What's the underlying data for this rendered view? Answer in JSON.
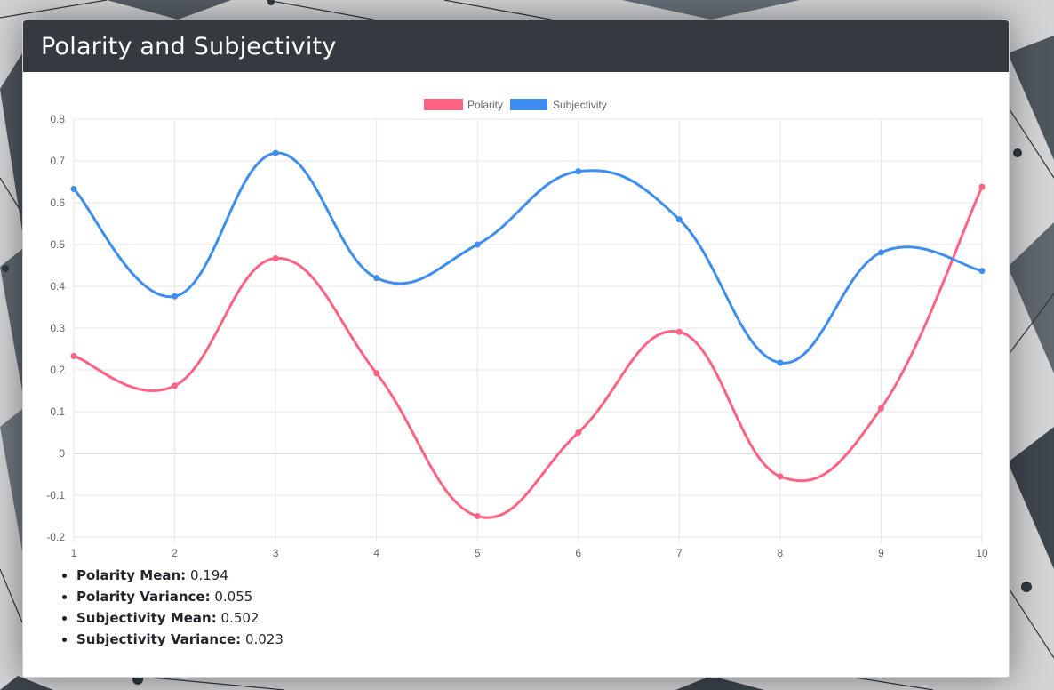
{
  "header": {
    "title": "Polarity and Subjectivity"
  },
  "chart_data": {
    "type": "line",
    "x": [
      1,
      2,
      3,
      4,
      5,
      6,
      7,
      8,
      9,
      10
    ],
    "ylim": [
      -0.2,
      0.8
    ],
    "yticks": [
      "0.8",
      "0.7",
      "0.6",
      "0.5",
      "0.4",
      "0.3",
      "0.2",
      "0.1",
      "0",
      "-0.1",
      "-0.2"
    ],
    "xticks": [
      "1",
      "2",
      "3",
      "4",
      "5",
      "6",
      "7",
      "8",
      "9",
      "10"
    ],
    "grid": true,
    "smooth": true,
    "legend_position": "top",
    "title": "",
    "xlabel": "",
    "ylabel": "",
    "series": [
      {
        "name": "Polarity",
        "color": "#ff6384",
        "values": [
          0.233,
          0.162,
          0.467,
          0.192,
          -0.15,
          0.05,
          0.291,
          -0.055,
          0.108,
          0.638
        ]
      },
      {
        "name": "Subjectivity",
        "color": "#3e8df0",
        "values": [
          0.633,
          0.376,
          0.719,
          0.42,
          0.5,
          0.675,
          0.56,
          0.217,
          0.481,
          0.437
        ]
      }
    ]
  },
  "stats": [
    {
      "label": "Polarity Mean:",
      "value": "0.194"
    },
    {
      "label": "Polarity Variance:",
      "value": "0.055"
    },
    {
      "label": "Subjectivity Mean:",
      "value": "0.502"
    },
    {
      "label": "Subjectivity Variance:",
      "value": "0.023"
    }
  ]
}
